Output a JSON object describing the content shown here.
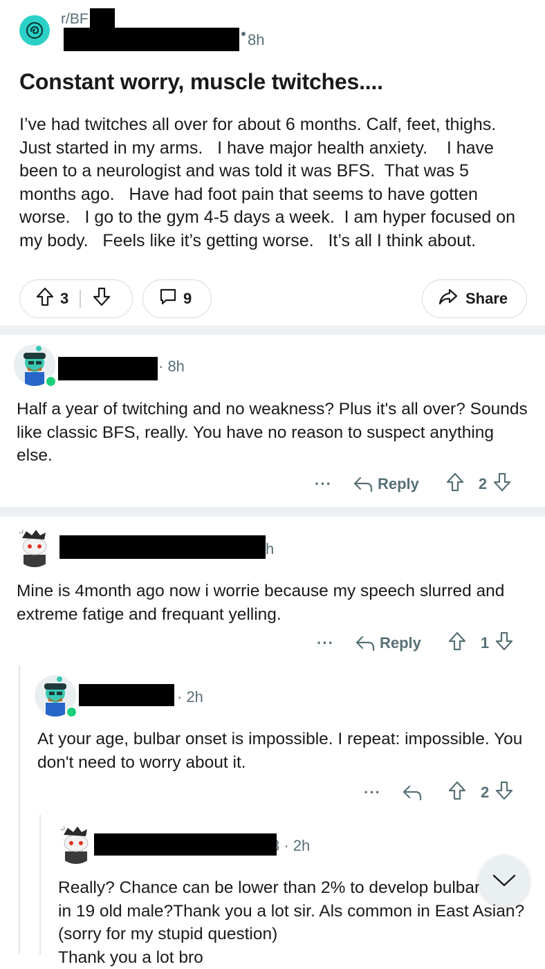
{
  "post": {
    "subreddit": "r/BF",
    "time": "8h",
    "title": "Constant worry, muscle twitches....",
    "body": "I’ve had twitches all over for about 6 months. Calf, feet, thighs.  Just started in my arms.   I have major health anxiety.    I have been to a neurologist and was told it was BFS.  That was 5 months ago.   Have had foot pain that seems to have gotten worse.   I go to the gym 4-5 days a week.  I am hyper focused on my body.   Feels like it’s getting worse.   It’s all I think about.",
    "upvotes": "3",
    "comments": "9",
    "share_label": "Share"
  },
  "comments": [
    {
      "time": "· 8h",
      "text": "Half a year of twitching and no weakness? Plus it's all over? Sounds like classic BFS, really. You have no reason to suspect anything else.",
      "reply_label": "Reply",
      "votes": "2",
      "more": "···"
    },
    {
      "time": "h",
      "text": "Mine is 4month ago now i worrie because my speech slurred and extreme fatige and frequant yelling.",
      "reply_label": "Reply",
      "votes": "1",
      "more": "···"
    },
    {
      "time": "· 2h",
      "text": "At your age, bulbar onset is impossible. I repeat: impossible. You don't need to worry about it.",
      "votes": "2",
      "more": "···"
    },
    {
      "time": "3 · 2h",
      "text": "Really? Chance can be lower than 2% to develop bulbar onset in 19 old male?Thank you a lot sir. Als common in East Asian?(sorry for my stupid question)\nThank you a lot bro"
    }
  ],
  "colors": {
    "accent": "#2bd1c6",
    "online": "#1ccf7a",
    "meta": "#576f76",
    "separator": "#eef1f3"
  },
  "icons": {
    "upvote": "arrow-up-icon",
    "downvote": "arrow-down-icon",
    "comment": "speech-bubble-icon",
    "share": "share-arrow-icon",
    "reply": "reply-arrow-icon",
    "collapse": "chevron-down-icon"
  }
}
